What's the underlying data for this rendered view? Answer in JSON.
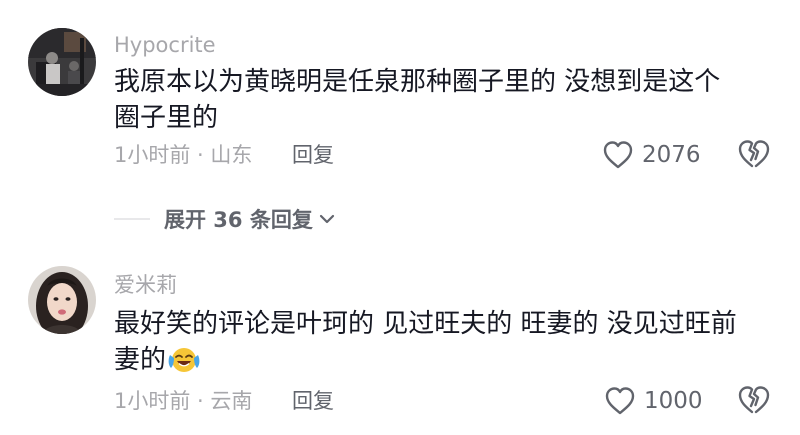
{
  "comments": [
    {
      "username": "Hypocrite",
      "text_lines": [
        "我原本以为黄晓明是任泉那种圈子里的 没想到是这个",
        "圈子里的"
      ],
      "time_location": "1小时前 · 山东",
      "reply_label": "回复",
      "likes": "2076",
      "avatar_icon": "user-photo-dark-room"
    },
    {
      "username": "爱米莉",
      "text_lines": [
        "最好笑的评论是叶珂的 见过旺夫的 旺妻的 没见过旺前",
        "妻的"
      ],
      "emoji": "laughing-crying-emoji",
      "time_location": "1小时前 · 云南",
      "reply_label": "回复",
      "likes": "1000",
      "avatar_icon": "user-photo-woman-portrait"
    }
  ],
  "expand_replies": {
    "label": "展开 36 条回复",
    "icon": "chevron-down-icon"
  },
  "colors": {
    "primary_text": "#161823",
    "secondary_text": "#a7a7ab",
    "action_text": "#61646c",
    "divider": "#e8e8ea"
  }
}
